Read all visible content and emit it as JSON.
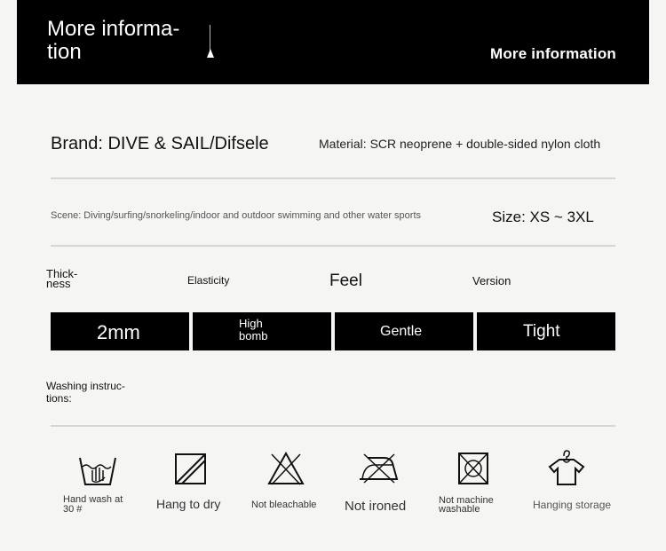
{
  "header": {
    "title": "More informa-\ntion",
    "subtitle": "More information"
  },
  "brand": "Brand: DIVE & SAIL/Difsele",
  "material": "Material: SCR neoprene + double-sided nylon cloth",
  "scene": "Scene: Diving/surfing/snorkeling/indoor and outdoor swimming and other water sports",
  "size": "Size: XS ~ 3XL",
  "specs": {
    "labels": {
      "thickness": "Thick-\nness",
      "elasticity": "Elasticity",
      "feel": "Feel",
      "version": "Version"
    },
    "values": {
      "thickness": "2mm",
      "elasticity": "High\nbomb",
      "feel": "Gentle",
      "version": "Tight"
    }
  },
  "washing_title": "Washing instruc-\ntions:",
  "care_items": [
    {
      "icon": "hand-wash-icon",
      "label": "Hand wash at\n30 #"
    },
    {
      "icon": "dry-flat-icon",
      "label": "Hang to dry"
    },
    {
      "icon": "no-bleach-icon",
      "label": "Not bleachable"
    },
    {
      "icon": "no-iron-icon",
      "label": "Not ironed"
    },
    {
      "icon": "no-machine-wash-icon",
      "label": "Not machine\nwashable"
    },
    {
      "icon": "hanging-storage-icon",
      "label": "Hanging storage"
    }
  ],
  "colors": {
    "background": "#f5f5f4",
    "banner": "#000000",
    "spec_box": "#000000",
    "divider": "#d6d6d6"
  }
}
